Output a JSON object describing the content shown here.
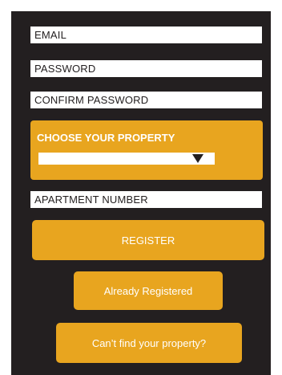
{
  "form": {
    "email_placeholder": "EMAIL",
    "password_placeholder": "PASSWORD",
    "confirm_password_placeholder": "CONFIRM PASSWORD",
    "apartment_placeholder": "APARTMENT NUMBER"
  },
  "property": {
    "title": "CHOOSE YOUR PROPERTY",
    "selected": "",
    "arrow_icon": "triangle-down-icon"
  },
  "buttons": {
    "register": "REGISTER",
    "already_registered": "Already Registered",
    "cant_find": "Can’t find your property?"
  },
  "colors": {
    "background": "#231f20",
    "accent": "#e8a51f",
    "field": "#ffffff"
  }
}
